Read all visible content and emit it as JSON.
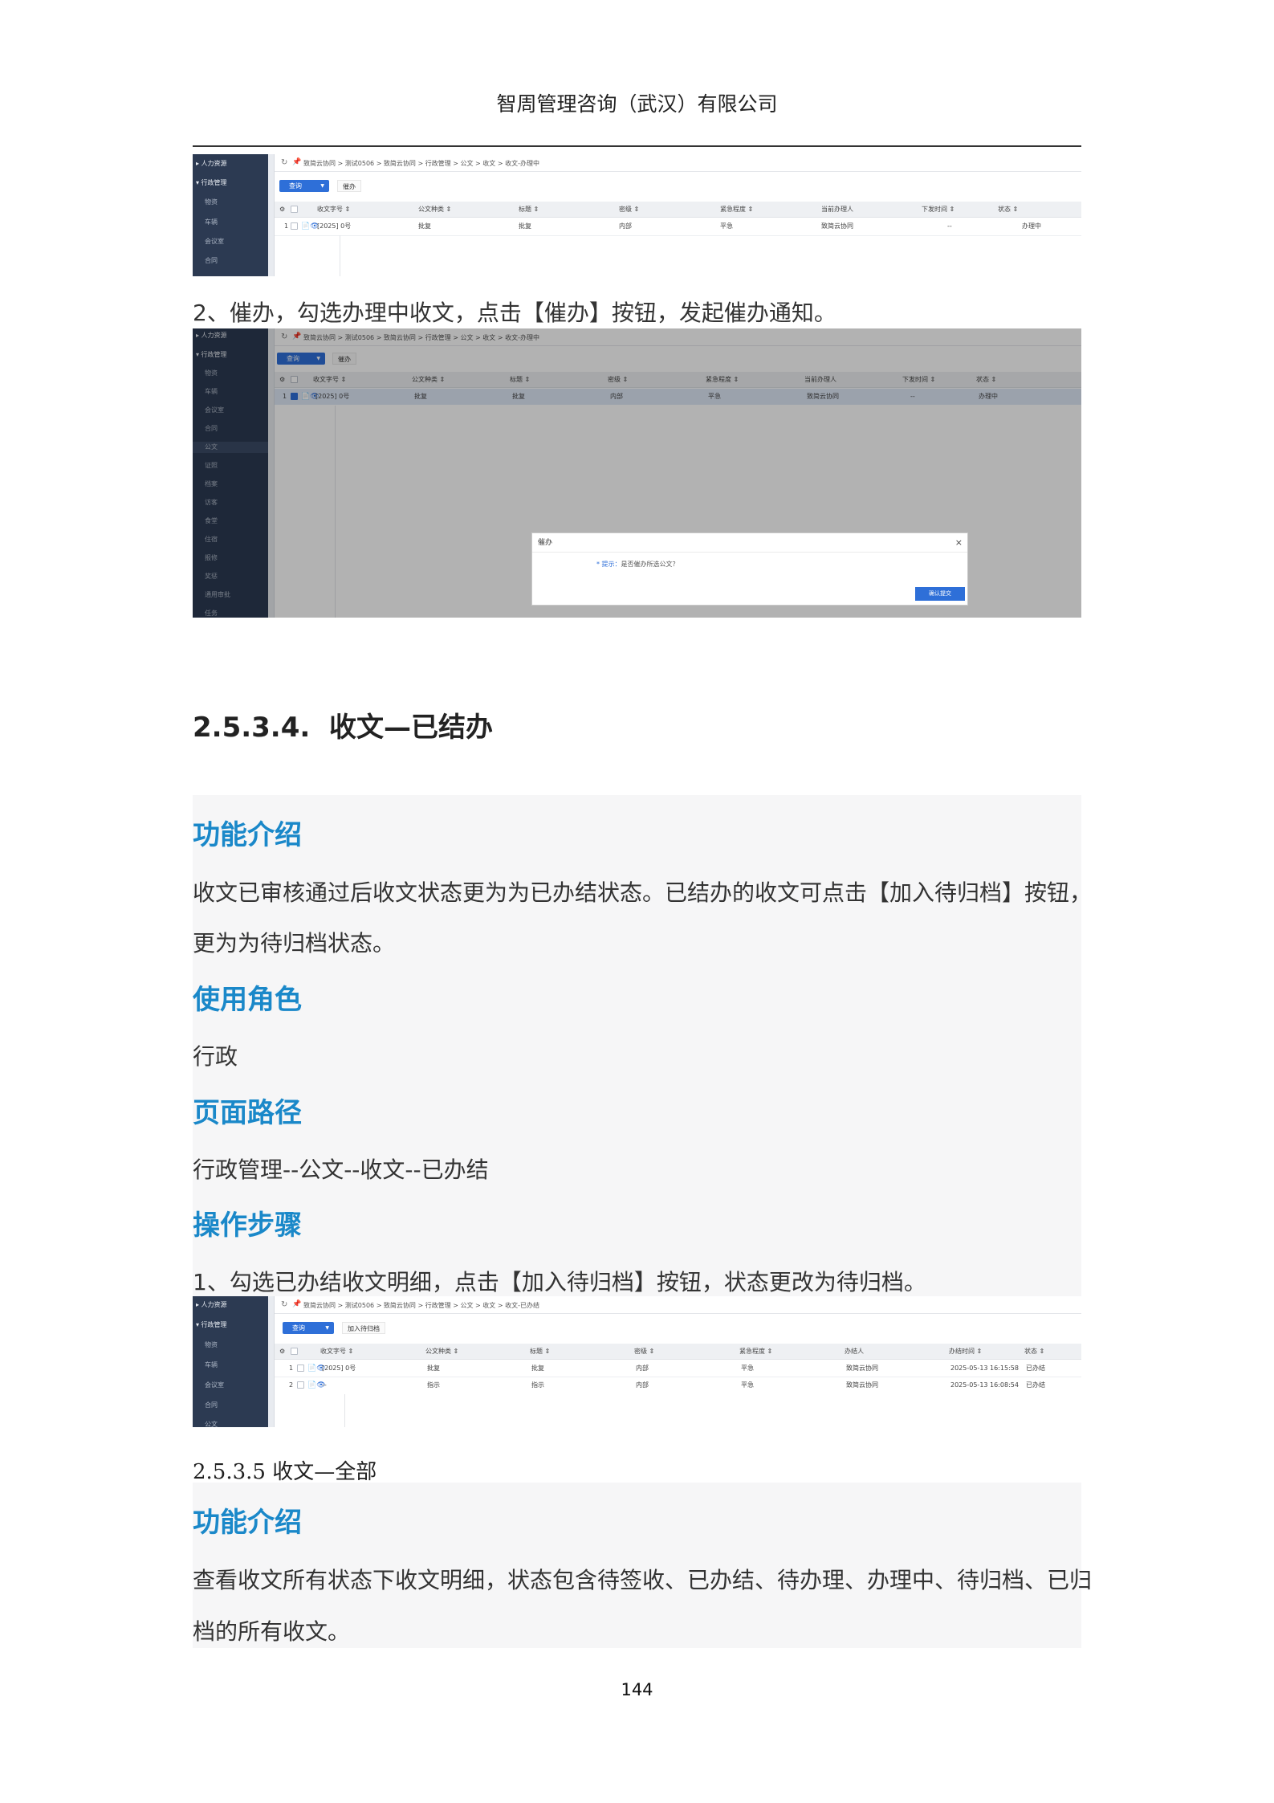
{
  "header": {
    "company": "智周管理咨询（武汉）有限公司"
  },
  "app": {
    "sidebar": {
      "hr": "▸ 人力资源",
      "admin": "▾ 行政管理",
      "items": [
        "物资",
        "车辆",
        "会议室",
        "合同",
        "公文",
        "证照",
        "档案",
        "访客",
        "食堂",
        "住宿",
        "报修",
        "奖惩",
        "通用审批",
        "任务"
      ]
    },
    "query_label": "查询",
    "refresh_icon": "↻",
    "pin_icon": "📌",
    "gear_icon": "⚙",
    "doc_icons": "📄👁",
    "columns": {
      "doc_no": "收文字号 ⇕",
      "type": "公文种类 ⇕",
      "title": "标题 ⇕",
      "secret": "密级 ⇕",
      "urgency": "紧急程度 ⇕",
      "handler_current": "当前办理人",
      "handler": "办结人",
      "issue_time": "下发时间 ⇕",
      "finish_time": "办结时间 ⇕",
      "status": "状态 ⇕"
    }
  },
  "shot1": {
    "breadcrumb": "致简云协同 > 测试0506 > 致简云协同 > 行政管理 > 公文 > 收文 > 收文-办理中",
    "tool": "催办",
    "row": {
      "no": "1",
      "doc_no": "[2025] 0号",
      "type": "批复",
      "title": "批复",
      "secret": "内部",
      "urgency": "平急",
      "handler": "致简云协同",
      "issue_time": "--",
      "status": "办理中"
    }
  },
  "step2": "2、催办，勾选办理中收文，点击【催办】按钮，发起催办通知。",
  "shot2": {
    "breadcrumb": "致简云协同 > 测试0506 > 致简云协同 > 行政管理 > 公文 > 收文 > 收文-办理中",
    "tool": "催办",
    "row": {
      "no": "1",
      "doc_no": "[2025] 0号",
      "type": "批复",
      "title": "批复",
      "secret": "内部",
      "urgency": "平急",
      "handler": "致简云协同",
      "issue_time": "--",
      "status": "办理中"
    },
    "dialog": {
      "title": "催办",
      "close": "×",
      "tip": "* 提示：",
      "message": "是否催办所选公文？",
      "ok": "确认提交"
    }
  },
  "section": {
    "number": "2.5.3.4.",
    "title": "收文—已结办"
  },
  "s1": {
    "h_intro": "功能介绍",
    "intro_line1": "收文已审核通过后收文状态更为为已办结状态。已结办的收文可点击【加入待归档】按钮，",
    "intro_line2": "更为为待归档状态。",
    "h_role": "使用角色",
    "role": "行政",
    "h_path": "页面路径",
    "path": "行政管理--公文--收文--已办结",
    "h_steps": "操作步骤",
    "step1": "1、勾选已办结收文明细，点击【加入待归档】按钮，状态更改为待归档。"
  },
  "shot3": {
    "breadcrumb": "致简云协同 > 测试0506 > 致简云协同 > 行政管理 > 公文 > 收文 > 收文-已办结",
    "tool": "加入待归档",
    "rows": [
      {
        "no": "1",
        "doc_no": "[2025] 0号",
        "type": "批复",
        "title": "批复",
        "secret": "内部",
        "urgency": "平急",
        "handler": "致简云协同",
        "time": "2025-05-13 16:15:58",
        "status": "已办结"
      },
      {
        "no": "2",
        "doc_no": "--",
        "type": "指示",
        "title": "指示",
        "secret": "内部",
        "urgency": "平急",
        "handler": "致简云协同",
        "time": "2025-05-13 16:08:54",
        "status": "已办结"
      }
    ]
  },
  "section2": "2.5.3.5  收文—全部",
  "s2": {
    "h_intro": "功能介绍",
    "intro_line1": "查看收文所有状态下收文明细，状态包含待签收、已办结、待办理、办理中、待归档、已归",
    "intro_line2": "档的所有收文。"
  },
  "page": "144"
}
